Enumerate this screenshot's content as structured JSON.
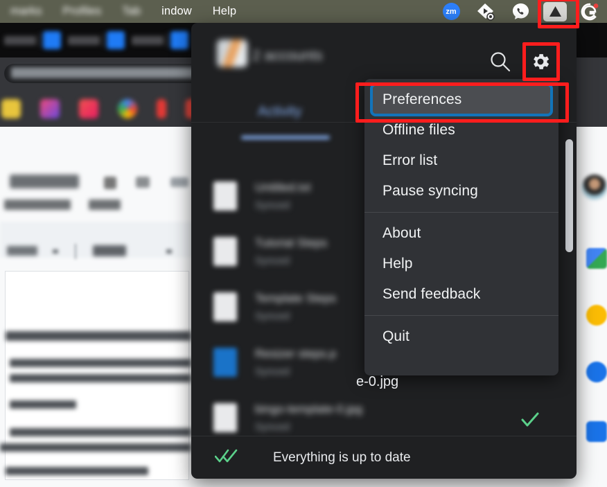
{
  "menubar": {
    "items": [
      {
        "label": "marks",
        "blurred": true,
        "name": "menu-bookmarks"
      },
      {
        "label": "Profiles",
        "blurred": true,
        "name": "menu-profiles"
      },
      {
        "label": "Tab",
        "blurred": true,
        "name": "menu-tab"
      },
      {
        "label": "indow",
        "blurred": false,
        "name": "menu-window"
      },
      {
        "label": "Help",
        "blurred": false,
        "name": "menu-help"
      }
    ],
    "status_icons": [
      {
        "name": "zoom-icon",
        "label": "zm"
      },
      {
        "name": "media-diamond-icon",
        "label": ""
      },
      {
        "name": "phone-icon",
        "label": ""
      },
      {
        "name": "google-drive-icon",
        "label": "",
        "highlighted": true
      },
      {
        "name": "grammarly-icon",
        "label": "G",
        "badge": true
      }
    ]
  },
  "drive_panel": {
    "accounts_label": "2 accounts",
    "search_icon": "search-icon",
    "settings_icon": "gear-icon",
    "tab_label": "Activity",
    "files": [
      {
        "name": "Untitled.txt",
        "status": "Synced",
        "icon": "document-icon"
      },
      {
        "name": "Tutorial Steps",
        "status": "Synced",
        "icon": "document-icon"
      },
      {
        "name": "Template Steps",
        "status": "Synced",
        "icon": "document-icon"
      },
      {
        "name": "Resizer steps.p",
        "status": "Synced",
        "icon": "slides-icon"
      },
      {
        "name": "bingo-template-0.jpg",
        "status": "Synced",
        "icon": "image-icon"
      }
    ],
    "visible_filename_fragment": "e-0.jpg",
    "footer": {
      "status_text": "Everything is up to date",
      "status_icon": "double-check-icon"
    }
  },
  "gear_menu": {
    "groups": [
      [
        {
          "label": "Preferences",
          "highlighted": true,
          "name": "menu-item-preferences"
        },
        {
          "label": "Offline files",
          "highlighted": false,
          "name": "menu-item-offline-files"
        },
        {
          "label": "Error list",
          "highlighted": false,
          "name": "menu-item-error-list"
        },
        {
          "label": "Pause syncing",
          "highlighted": false,
          "name": "menu-item-pause-syncing"
        }
      ],
      [
        {
          "label": "About",
          "highlighted": false,
          "name": "menu-item-about"
        },
        {
          "label": "Help",
          "highlighted": false,
          "name": "menu-item-help"
        },
        {
          "label": "Send feedback",
          "highlighted": false,
          "name": "menu-item-send-feedback"
        }
      ],
      [
        {
          "label": "Quit",
          "highlighted": false,
          "name": "menu-item-quit"
        }
      ]
    ]
  },
  "colors": {
    "menubar_bg": "#5c5f4f",
    "panel_bg": "#1f2022",
    "menu_bg": "#303236",
    "highlight_red": "#ff1d1d",
    "highlight_blue": "#1274ba",
    "accent_blue": "#8ab4f8",
    "success_green": "#5bd08a"
  }
}
